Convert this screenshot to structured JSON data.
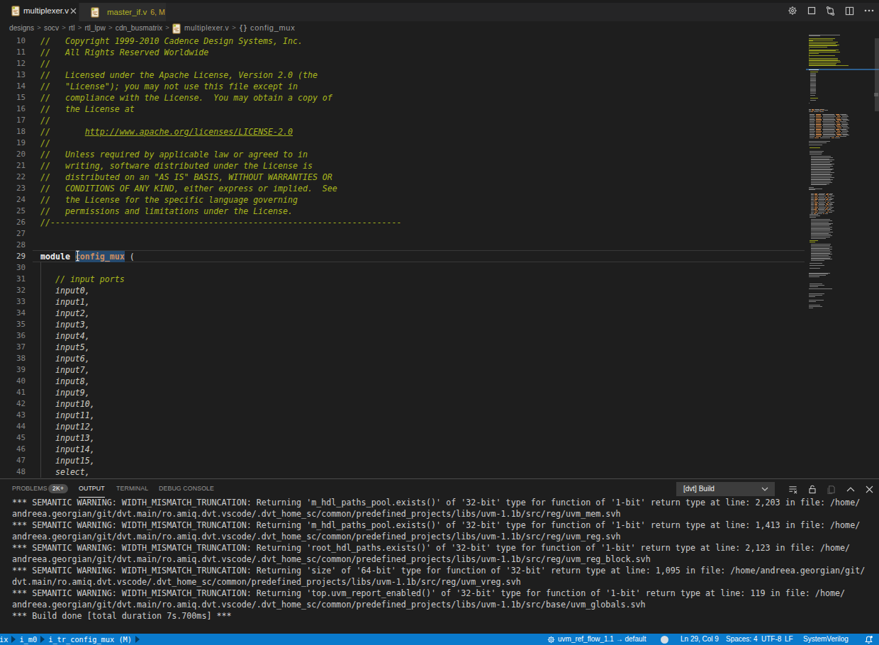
{
  "colors": {
    "editor_background": "#1e1e1e",
    "tab_bar_background": "#252526",
    "inactive_tab_background": "#2d2d2d",
    "status_bar_background": "#0a7acc",
    "comment_text": "#a9b71d",
    "module_name_text": "#cd8d5f",
    "selection_background": "#264a6e",
    "warning_tab_text": "#b4b424",
    "line_number_text": "#858585",
    "output_text": "#cccccc"
  },
  "tab_bar": {
    "tabs": [
      {
        "name": "multiplexer.v",
        "state": "active",
        "decoration": ""
      },
      {
        "name": "master_if.v",
        "state": "inactive",
        "decoration": "6, M"
      }
    ],
    "actions": [
      "settings-gear",
      "stop-build",
      "sync",
      "split-editor",
      "more-actions"
    ]
  },
  "breadcrumbs": {
    "separator": ">",
    "items": [
      {
        "label": "designs"
      },
      {
        "label": "socv"
      },
      {
        "label": "rtl"
      },
      {
        "label": "rtl_lpw"
      },
      {
        "label": "cdn_busmatrix"
      },
      {
        "label": "multiplexer.v",
        "icon": "verilog-file"
      },
      {
        "label": "config_mux",
        "icon": "braces-symbol"
      }
    ],
    "braces_glyph": "{}"
  },
  "editor": {
    "first_visible_line": 10,
    "cursor_line": 29,
    "selected_word": "config_mux",
    "lines": [
      {
        "n": 10,
        "seg": [
          [
            "c",
            "//   Copyright 1999-2010 Cadence Design Systems, Inc."
          ]
        ]
      },
      {
        "n": 11,
        "seg": [
          [
            "c",
            "//   All Rights Reserved Worldwide"
          ]
        ]
      },
      {
        "n": 12,
        "seg": [
          [
            "c",
            "//"
          ]
        ]
      },
      {
        "n": 13,
        "seg": [
          [
            "c",
            "//   Licensed under the Apache License, Version 2.0 (the"
          ]
        ]
      },
      {
        "n": 14,
        "seg": [
          [
            "c",
            "//   \"License\"); you may not use this file except in"
          ]
        ]
      },
      {
        "n": 15,
        "seg": [
          [
            "c",
            "//   compliance with the License.  You may obtain a copy of"
          ]
        ]
      },
      {
        "n": 16,
        "seg": [
          [
            "c",
            "//   the License at"
          ]
        ]
      },
      {
        "n": 17,
        "seg": [
          [
            "c",
            "//"
          ]
        ]
      },
      {
        "n": 18,
        "seg": [
          [
            "c",
            "//       "
          ],
          [
            "u",
            "http://www.apache.org/licenses/LICENSE-2.0"
          ]
        ]
      },
      {
        "n": 19,
        "seg": [
          [
            "c",
            "//"
          ]
        ]
      },
      {
        "n": 20,
        "seg": [
          [
            "c",
            "//   Unless required by applicable law or agreed to in"
          ]
        ]
      },
      {
        "n": 21,
        "seg": [
          [
            "c",
            "//   writing, software distributed under the License is"
          ]
        ]
      },
      {
        "n": 22,
        "seg": [
          [
            "c",
            "//   distributed on an \"AS IS\" BASIS, WITHOUT WARRANTIES OR"
          ]
        ]
      },
      {
        "n": 23,
        "seg": [
          [
            "c",
            "//   CONDITIONS OF ANY KIND, either express or implied.  See"
          ]
        ]
      },
      {
        "n": 24,
        "seg": [
          [
            "c",
            "//   the License for the specific language governing"
          ]
        ]
      },
      {
        "n": 25,
        "seg": [
          [
            "c",
            "//   permissions and limitations under the License."
          ]
        ]
      },
      {
        "n": 26,
        "seg": [
          [
            "c",
            "//-----------------------------------------------------------------------"
          ]
        ]
      },
      {
        "n": 27,
        "seg": []
      },
      {
        "n": 28,
        "seg": []
      },
      {
        "n": 29,
        "seg": [
          [
            "k",
            "module"
          ],
          [
            "p",
            " "
          ],
          [
            "s",
            "config_mux"
          ],
          [
            "p",
            " ("
          ]
        ]
      },
      {
        "n": 30,
        "seg": []
      },
      {
        "n": 31,
        "seg": [
          [
            "c",
            "   // input ports"
          ]
        ]
      },
      {
        "n": 32,
        "seg": [
          [
            "i",
            "   input0,"
          ]
        ]
      },
      {
        "n": 33,
        "seg": [
          [
            "i",
            "   input1,"
          ]
        ]
      },
      {
        "n": 34,
        "seg": [
          [
            "i",
            "   input2,"
          ]
        ]
      },
      {
        "n": 35,
        "seg": [
          [
            "i",
            "   input3,"
          ]
        ]
      },
      {
        "n": 36,
        "seg": [
          [
            "i",
            "   input4,"
          ]
        ]
      },
      {
        "n": 37,
        "seg": [
          [
            "i",
            "   input5,"
          ]
        ]
      },
      {
        "n": 38,
        "seg": [
          [
            "i",
            "   input6,"
          ]
        ]
      },
      {
        "n": 39,
        "seg": [
          [
            "i",
            "   input7,"
          ]
        ]
      },
      {
        "n": 40,
        "seg": [
          [
            "i",
            "   input8,"
          ]
        ]
      },
      {
        "n": 41,
        "seg": [
          [
            "i",
            "   input9,"
          ]
        ]
      },
      {
        "n": 42,
        "seg": [
          [
            "i",
            "   input10,"
          ]
        ]
      },
      {
        "n": 43,
        "seg": [
          [
            "i",
            "   input11,"
          ]
        ]
      },
      {
        "n": 44,
        "seg": [
          [
            "i",
            "   input12,"
          ]
        ]
      },
      {
        "n": 45,
        "seg": [
          [
            "i",
            "   input13,"
          ]
        ]
      },
      {
        "n": 46,
        "seg": [
          [
            "i",
            "   input14,"
          ]
        ]
      },
      {
        "n": 47,
        "seg": [
          [
            "i",
            "   input15,"
          ]
        ]
      },
      {
        "n": 48,
        "seg": [
          [
            "i",
            "   select,"
          ]
        ]
      }
    ]
  },
  "minimap": {
    "sections": [
      [
        1,
        1,
        "g",
        0,
        [
          60
        ]
      ],
      [
        2,
        1,
        "g",
        0,
        [
          22
        ]
      ],
      [
        4,
        6,
        "y",
        0,
        [
          50,
          46,
          8,
          56,
          52,
          58
        ]
      ],
      [
        10,
        17,
        "y",
        0,
        [
          54,
          35,
          2,
          57,
          52,
          60,
          19,
          2,
          50,
          2,
          55,
          55,
          60,
          61,
          53,
          52,
          75
        ]
      ],
      [
        29,
        1,
        "w",
        0,
        [
          19
        ]
      ],
      [
        31,
        1,
        "y",
        3,
        [
          14
        ]
      ],
      [
        32,
        17,
        "g",
        3,
        [
          10,
          10,
          10,
          10,
          10,
          10,
          10,
          10,
          10,
          10,
          11,
          11,
          11,
          11,
          11,
          11,
          10
        ]
      ],
      [
        50,
        1,
        "g",
        3,
        [
          9
        ]
      ],
      [
        52,
        1,
        "y",
        3,
        [
          15
        ]
      ],
      [
        54,
        1,
        "g",
        3,
        [
          10
        ]
      ],
      [
        56,
        1,
        "g",
        0,
        [
          2
        ]
      ],
      [
        61,
        3,
        "x",
        0,
        [
          30,
          36,
          28
        ]
      ],
      [
        65,
        20,
        "x",
        2,
        [
          70,
          72,
          74,
          71,
          73,
          75,
          70,
          72,
          74,
          71,
          73,
          75,
          70,
          72,
          74,
          71,
          73,
          75,
          70,
          58
        ]
      ],
      [
        87,
        2,
        "g",
        0,
        [
          40,
          34
        ]
      ],
      [
        90,
        1,
        "g",
        0,
        [
          26
        ]
      ],
      [
        92,
        1,
        "y",
        2,
        [
          20
        ]
      ],
      [
        95,
        3,
        "g",
        2,
        [
          26,
          24,
          22
        ]
      ],
      [
        99,
        24,
        "g",
        4,
        [
          38,
          42,
          35,
          44,
          40,
          36,
          45,
          39,
          42,
          37,
          43,
          40,
          38,
          44,
          36,
          41,
          39,
          45,
          37,
          42,
          38,
          40,
          35,
          30
        ]
      ],
      [
        124,
        3,
        "g",
        0,
        [
          10,
          26,
          12
        ]
      ],
      [
        129,
        17,
        "x",
        4,
        [
          42,
          40,
          44,
          39,
          43,
          41,
          38,
          44,
          40,
          42,
          39,
          43,
          41,
          38,
          44,
          40,
          32
        ]
      ],
      [
        146,
        3,
        "g",
        2,
        [
          16,
          20,
          12
        ]
      ],
      [
        150,
        16,
        "g",
        4,
        [
          36,
          40,
          34,
          42,
          38,
          35,
          41,
          37,
          40,
          36,
          42,
          34,
          38,
          40,
          36,
          28
        ]
      ],
      [
        167,
        2,
        "y",
        2,
        [
          16,
          10
        ]
      ],
      [
        170,
        14,
        "g",
        4,
        [
          38,
          36,
          40,
          35,
          41,
          37,
          39,
          36,
          40,
          34,
          38,
          36,
          40,
          26
        ]
      ],
      [
        185,
        1,
        "g",
        2,
        [
          24
        ]
      ],
      [
        187,
        1,
        "g",
        2,
        [
          28
        ]
      ],
      [
        189,
        1,
        "g",
        2,
        [
          20
        ]
      ],
      [
        193,
        4,
        "g",
        0,
        [
          40,
          36,
          32,
          20
        ]
      ],
      [
        202,
        3,
        "g",
        2,
        [
          24,
          28,
          16
        ]
      ],
      [
        206,
        1,
        "g",
        0,
        [
          45
        ]
      ],
      [
        210,
        3,
        "g",
        0,
        [
          30,
          26,
          12
        ]
      ],
      [
        215,
        2,
        "g",
        0,
        [
          28,
          14
        ]
      ],
      [
        219,
        3,
        "g",
        0,
        [
          22,
          25,
          8
        ]
      ]
    ]
  },
  "panel": {
    "tabs": [
      {
        "label": "PROBLEMS",
        "badge": "2K+"
      },
      {
        "label": "OUTPUT",
        "active": true
      },
      {
        "label": "TERMINAL"
      },
      {
        "label": "DEBUG CONSOLE"
      }
    ],
    "channel_select": "[dvt] Build",
    "actions": [
      "clear-output",
      "lock-scroll",
      "open-in-editor",
      "maximize-panel",
      "close-panel"
    ],
    "output_lines": [
      "*** SEMANTIC WARNING: WIDTH_MISMATCH_TRUNCATION: Returning 'm_hdl_paths_pool.exists()' of '32-bit' type for function of '1-bit' return type at line: 2,203 in file: /home/",
      "andreea.georgian/git/dvt.main/ro.amiq.dvt.vscode/.dvt_home_sc/common/predefined_projects/libs/uvm-1.1b/src/reg/uvm_mem.svh",
      "*** SEMANTIC WARNING: WIDTH_MISMATCH_TRUNCATION: Returning 'm_hdl_paths_pool.exists()' of '32-bit' type for function of '1-bit' return type at line: 1,413 in file: /home/",
      "andreea.georgian/git/dvt.main/ro.amiq.dvt.vscode/.dvt_home_sc/common/predefined_projects/libs/uvm-1.1b/src/reg/uvm_reg.svh",
      "*** SEMANTIC WARNING: WIDTH_MISMATCH_TRUNCATION: Returning 'root_hdl_paths.exists()' of '32-bit' type for function of '1-bit' return type at line: 2,123 in file: /home/",
      "andreea.georgian/git/dvt.main/ro.amiq.dvt.vscode/.dvt_home_sc/common/predefined_projects/libs/uvm-1.1b/src/reg/uvm_reg_block.svh",
      "*** SEMANTIC WARNING: WIDTH_MISMATCH_TRUNCATION: Returning 'size' of '64-bit' type for function of '32-bit' return type at line: 1,095 in file: /home/andreea.georgian/git/",
      "dvt.main/ro.amiq.dvt.vscode/.dvt_home_sc/common/predefined_projects/libs/uvm-1.1b/src/reg/uvm_vreg.svh",
      "*** SEMANTIC WARNING: WIDTH_MISMATCH_TRUNCATION: Returning 'top.uvm_report_enabled()' of '32-bit' type for function of '1-bit' return type at line: 119 in file: /home/",
      "andreea.georgian/git/dvt.main/ro.amiq.dvt.vscode/.dvt_home_sc/common/predefined_projects/libs/uvm-1.1b/src/base/uvm_globals.svh",
      "*** Build done [total duration 7s.700ms] ***"
    ]
  },
  "status_bar": {
    "left_items": [
      {
        "label": "ix"
      },
      {
        "label": "i_m0"
      },
      {
        "label": "i_tr_config_mux (M)"
      }
    ],
    "right_items": [
      {
        "icon": "gear",
        "label": "uvm_ref_flow_1.1 → default"
      },
      {
        "icon": "circle",
        "label": ""
      },
      {
        "label": "Ln 29, Col 9"
      },
      {
        "label": "Spaces: 4"
      },
      {
        "label": "UTF-8"
      },
      {
        "label": "LF"
      },
      {
        "label": "SystemVerilog"
      },
      {
        "icon": "bell",
        "label": ""
      }
    ]
  }
}
